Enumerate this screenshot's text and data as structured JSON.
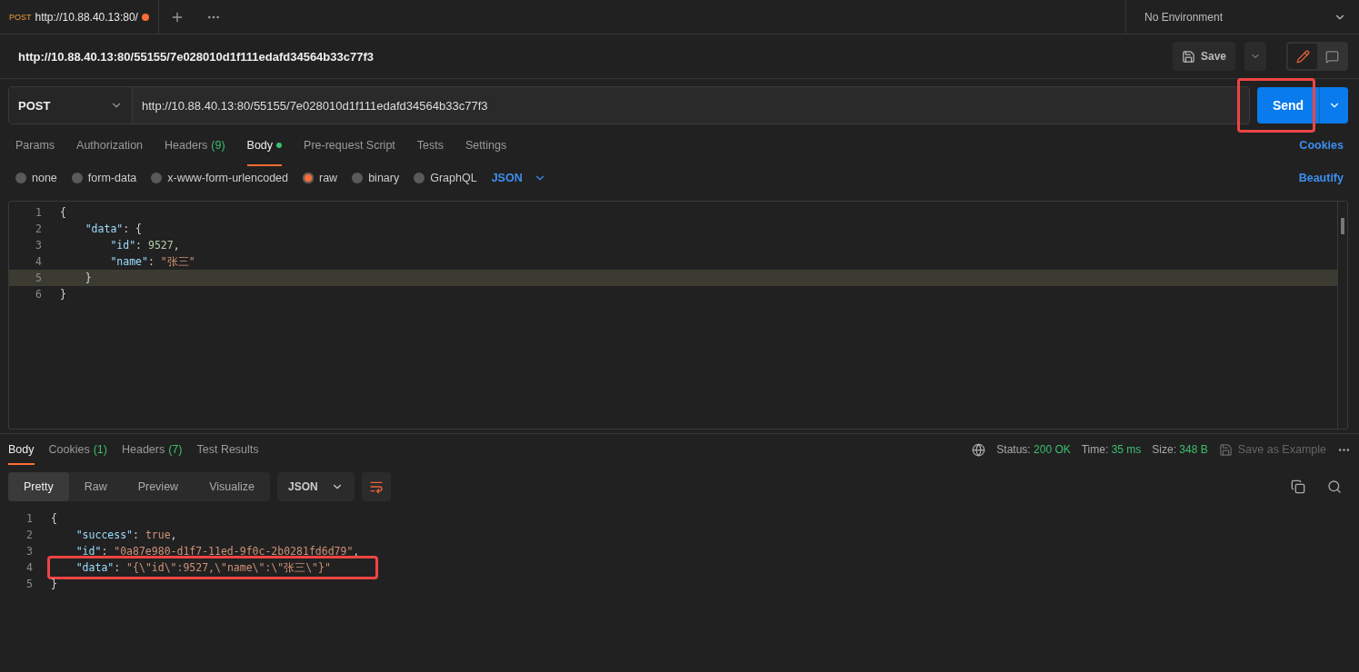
{
  "tab": {
    "method": "POST",
    "title": "http://10.88.40.13:80/",
    "unsaved": true
  },
  "environment": "No Environment",
  "request_title": "http://10.88.40.13:80/55155/7e028010d1f111edafd34564b33c77f3",
  "save_label": "Save",
  "method": "POST",
  "url": "http://10.88.40.13:80/55155/7e028010d1f111edafd34564b33c77f3",
  "send": {
    "label": "Send",
    "annotated": true
  },
  "request_tabs": [
    {
      "label": "Params",
      "dot": false,
      "selected": false
    },
    {
      "label": "Authorization",
      "dot": false,
      "selected": false
    },
    {
      "label": "Headers",
      "count": "(9)",
      "dot": false,
      "selected": false
    },
    {
      "label": "Body",
      "dot": true,
      "selected": true
    },
    {
      "label": "Pre-request Script",
      "dot": false,
      "selected": false
    },
    {
      "label": "Tests",
      "dot": false,
      "selected": false
    },
    {
      "label": "Settings",
      "dot": false,
      "selected": false
    }
  ],
  "cookies_link": "Cookies",
  "body_types": [
    {
      "label": "none",
      "selected": false
    },
    {
      "label": "form-data",
      "selected": false
    },
    {
      "label": "x-www-form-urlencoded",
      "selected": false
    },
    {
      "label": "raw",
      "selected": true
    },
    {
      "label": "binary",
      "selected": false
    },
    {
      "label": "GraphQL",
      "selected": false
    }
  ],
  "body_format": "JSON",
  "beautify": "Beautify",
  "request_body": [
    {
      "number": "1",
      "current": false,
      "tokens": [
        {
          "kind": "punct",
          "text": "{"
        }
      ]
    },
    {
      "number": "2",
      "current": false,
      "tokens": [
        {
          "kind": "key",
          "text": "    \"data\""
        },
        {
          "kind": "punct",
          "text": ": {"
        }
      ]
    },
    {
      "number": "3",
      "current": false,
      "tokens": [
        {
          "kind": "key",
          "text": "        \"id\""
        },
        {
          "kind": "punct",
          "text": ": "
        },
        {
          "kind": "number",
          "text": "9527"
        },
        {
          "kind": "punct",
          "text": ","
        }
      ]
    },
    {
      "number": "4",
      "current": false,
      "tokens": [
        {
          "kind": "key",
          "text": "        \"name\""
        },
        {
          "kind": "punct",
          "text": ": "
        },
        {
          "kind": "string",
          "text": "\"张三\""
        }
      ]
    },
    {
      "number": "5",
      "current": true,
      "tokens": [
        {
          "kind": "punct",
          "text": "    }"
        }
      ]
    },
    {
      "number": "6",
      "current": false,
      "tokens": [
        {
          "kind": "punct",
          "text": "}"
        }
      ]
    }
  ],
  "response_tabs": [
    {
      "label": "Body",
      "selected": true
    },
    {
      "label": "Cookies",
      "count": "(1)",
      "selected": false
    },
    {
      "label": "Headers",
      "count": "(7)",
      "selected": false
    },
    {
      "label": "Test Results",
      "selected": false
    }
  ],
  "stats": [
    {
      "label": "Status:",
      "value": "200 OK"
    },
    {
      "label": "Time:",
      "value": "35 ms"
    },
    {
      "label": "Size:",
      "value": "348 B"
    }
  ],
  "save_example": "Save as Example",
  "view_tabs": [
    {
      "label": "Pretty",
      "selected": true
    },
    {
      "label": "Raw",
      "selected": false
    },
    {
      "label": "Preview",
      "selected": false
    },
    {
      "label": "Visualize",
      "selected": false
    }
  ],
  "response_format": "JSON",
  "response_body": [
    {
      "number": "1",
      "annotated": false,
      "tokens": [
        {
          "kind": "punct",
          "text": "{"
        }
      ]
    },
    {
      "number": "2",
      "annotated": false,
      "tokens": [
        {
          "kind": "key",
          "text": "    \"success\""
        },
        {
          "kind": "punct",
          "text": ": "
        },
        {
          "kind": "keyword",
          "text": "true"
        },
        {
          "kind": "punct",
          "text": ","
        }
      ]
    },
    {
      "number": "3",
      "annotated": false,
      "tokens": [
        {
          "kind": "key",
          "text": "    \"id\""
        },
        {
          "kind": "punct",
          "text": ": "
        },
        {
          "kind": "string",
          "text": "\"0a87e980-d1f7-11ed-9f0c-2b0281fd6d79\""
        },
        {
          "kind": "punct",
          "text": ","
        }
      ]
    },
    {
      "number": "4",
      "annotated": true,
      "tokens": [
        {
          "kind": "key",
          "text": "    \"data\""
        },
        {
          "kind": "punct",
          "text": ": "
        },
        {
          "kind": "string",
          "text": "\"{\\\"id\\\":9527,\\\"name\\\":\\\"张三\\\"}\""
        }
      ]
    },
    {
      "number": "5",
      "annotated": false,
      "tokens": [
        {
          "kind": "punct",
          "text": "}"
        }
      ]
    }
  ]
}
